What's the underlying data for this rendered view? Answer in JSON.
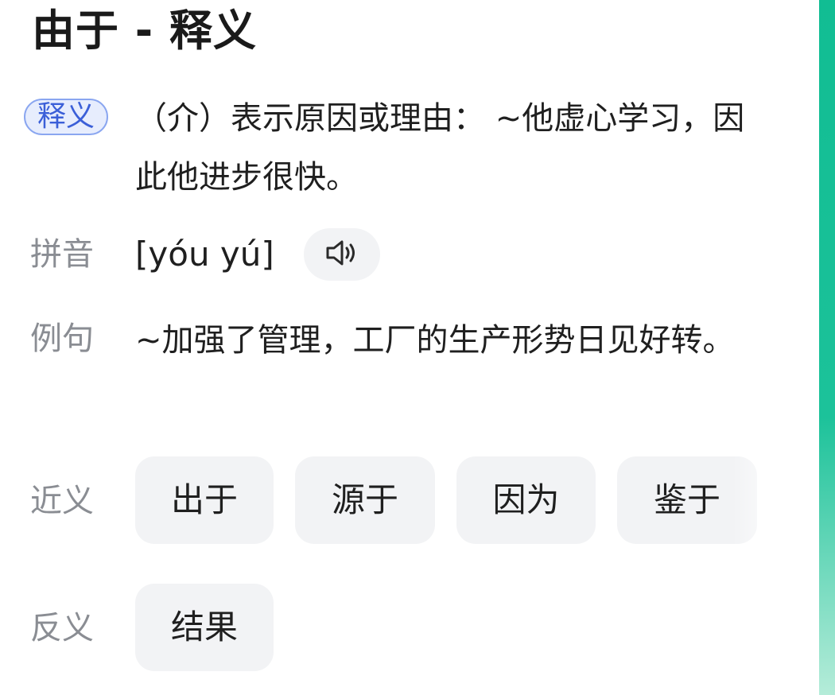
{
  "header": {
    "title": "由于 - 释义"
  },
  "definition": {
    "tag": "释义",
    "text": "（介）表示原因或理由： ~他虚心学习，因此他进步很快。"
  },
  "pinyin": {
    "label": "拼音",
    "value": "[yóu yú]",
    "audio_icon": "speaker-icon"
  },
  "example": {
    "label": "例句",
    "text": "~加强了管理，工厂的生产形势日见好转。"
  },
  "synonyms": {
    "label": "近义",
    "items": [
      "出于",
      "源于",
      "因为",
      "鉴于"
    ]
  },
  "antonyms": {
    "label": "反义",
    "items": [
      "结果"
    ]
  },
  "colors": {
    "accent": "#3b5fd8",
    "tag_bg": "#e7edfd",
    "chip_bg": "#f2f3f5",
    "label_gray": "#8a8d93",
    "scrollbar": "#11bd93"
  }
}
